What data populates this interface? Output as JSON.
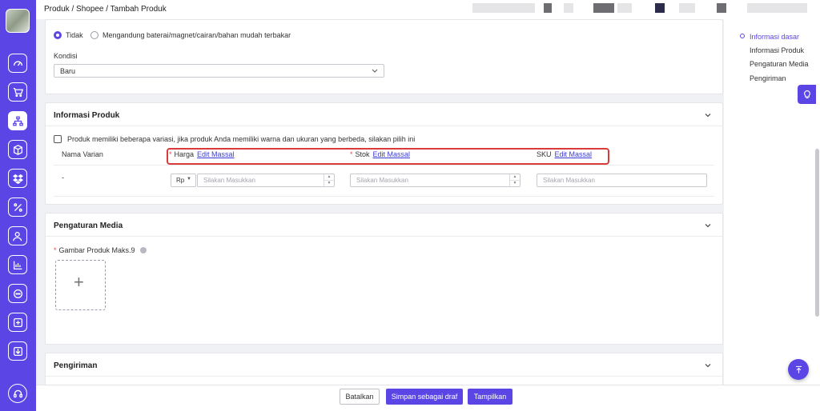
{
  "breadcrumb": "Produk / Shopee / Tambah Produk",
  "colors": {
    "accent": "#5b46e5",
    "highlight": "#d93a3a"
  },
  "sidebar": {
    "icons": [
      "dashboard-icon",
      "cart-icon",
      "product-tree-icon",
      "box-icon",
      "dropbox-icon",
      "percent-icon",
      "users-icon",
      "chart-icon",
      "chat-icon",
      "add-icon",
      "download-icon",
      "headset-icon"
    ],
    "active": "product-tree-icon"
  },
  "basic": {
    "radio_no": "Tidak",
    "radio_yes": "Mengandung baterai/magnet/cairan/bahan mudah terbakar",
    "condition_label": "Kondisi",
    "condition_value": "Baru"
  },
  "product_info": {
    "title": "Informasi Produk",
    "variation_text": "Produk memiliki beberapa variasi, jika produk Anda memiliki warna dan ukuran yang berbeda, silakan pilih ini",
    "variant_header": "Nama Varian",
    "price_label": "Harga",
    "stock_label": "Stok",
    "sku_label": "SKU",
    "edit_mass": "Edit Massal",
    "variant_value": "-",
    "currency": "Rp",
    "placeholder": "Silakan Masukkan"
  },
  "media": {
    "title": "Pengaturan Media",
    "image_label": "Gambar Produk Maks.9"
  },
  "shipping": {
    "title": "Pengiriman"
  },
  "anchors": [
    "Informasi dasar",
    "Informasi Produk",
    "Pengaturan Media",
    "Pengiriman"
  ],
  "footer": {
    "cancel": "Batalkan",
    "draft": "Simpan sebagai draf",
    "publish": "Tampilkan"
  }
}
